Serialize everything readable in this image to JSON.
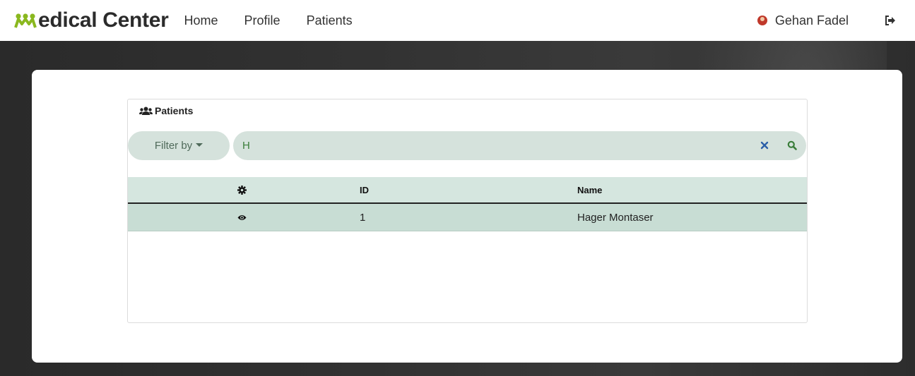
{
  "brand": {
    "name": "edical Center",
    "logo": "medical-logo-icon"
  },
  "nav": {
    "items": [
      {
        "label": "Home"
      },
      {
        "label": "Profile"
      },
      {
        "label": "Patients"
      }
    ]
  },
  "user": {
    "name": "Gehan Fadel",
    "avatar": "avatar-icon",
    "logout_icon": "sign-out-icon"
  },
  "panel": {
    "title": "Patients",
    "title_icon": "users-icon",
    "filter_label": "Filter by",
    "search_value": "H",
    "clear_icon": "close-icon",
    "search_icon": "search-icon"
  },
  "table": {
    "columns": [
      {
        "key": "action",
        "label": "",
        "icon": "gear-icon"
      },
      {
        "key": "id",
        "label": "ID"
      },
      {
        "key": "name",
        "label": "Name"
      }
    ],
    "rows": [
      {
        "action_icon": "eye-icon",
        "id": "1",
        "name": "Hager Montaser"
      }
    ]
  },
  "colors": {
    "brand_green": "#8ab81f",
    "panel_accent": "#d5e2dc",
    "row_selected": "#c8ddd4",
    "search_icon": "#3a7d3a",
    "clear_icon": "#2b5fa8"
  }
}
